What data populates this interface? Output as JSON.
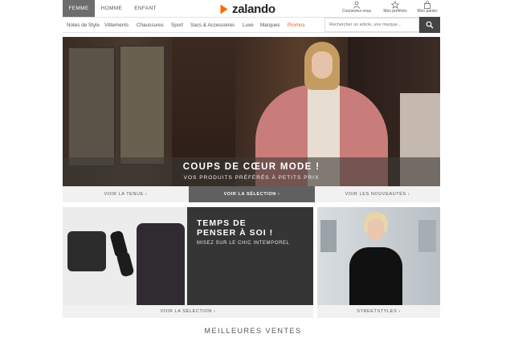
{
  "header": {
    "gender_tabs": [
      {
        "label": "FEMME",
        "active": true
      },
      {
        "label": "HOMME",
        "active": false
      },
      {
        "label": "ENFANT",
        "active": false
      }
    ],
    "logo_text": "zalando",
    "utilities": [
      {
        "label": "Connectez-vous",
        "icon": "person-icon"
      },
      {
        "label": "Mes préférés",
        "icon": "star-icon"
      },
      {
        "label": "Mon panier",
        "icon": "bag-icon"
      }
    ]
  },
  "nav": {
    "items": [
      {
        "label": "Notes de Style"
      },
      {
        "label": "Vêtements"
      },
      {
        "label": "Chaussures"
      },
      {
        "label": "Sport"
      },
      {
        "label": "Sacs & Accessoires"
      },
      {
        "label": "Luxe"
      },
      {
        "label": "Marques"
      },
      {
        "label": "Promos"
      }
    ],
    "search_placeholder": "Rechercher un article, une marque..."
  },
  "hero": {
    "title": "COUPS DE CŒUR MODE !",
    "subtitle": "VOS PRODUITS PRÉFÉRÉS À PETITS PRIX",
    "ctas": [
      {
        "label": "VOIR LA TENUE ›",
        "active": false
      },
      {
        "label": "VOIR LA SÉLECTION ›",
        "active": true
      },
      {
        "label": "VOIR LES NOUVEAUTÉS ›",
        "active": false
      }
    ]
  },
  "tiles": {
    "left": {
      "title_line1": "TEMPS DE",
      "title_line2": "PENSER À SOI !",
      "subtitle": "MISEZ SUR LE CHIC INTEMPOREL",
      "cta": "VOIR LA SÉLECTION ›"
    },
    "right": {
      "cta": "STREETSTYLES ›"
    }
  },
  "section_title": "MEILLEURES VENTES",
  "colors": {
    "brand_orange": "#ff6900",
    "promo": "#e8551c",
    "active_tab": "#6d6d6d"
  }
}
